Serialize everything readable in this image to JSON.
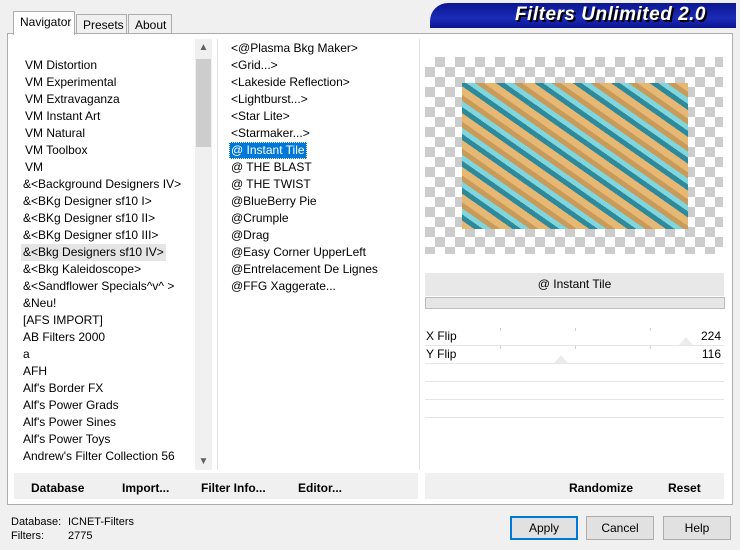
{
  "app": {
    "title": "Filters Unlimited 2.0"
  },
  "tabs": [
    {
      "label": "Navigator",
      "active": true
    },
    {
      "label": "Presets",
      "active": false
    },
    {
      "label": "About",
      "active": false
    }
  ],
  "categories": [
    "VM Distortion",
    "VM Experimental",
    "VM Extravaganza",
    "VM Instant Art",
    "VM Natural",
    "VM Toolbox",
    "VM",
    "&<Background Designers IV>",
    "&<BKg Designer sf10 I>",
    "&<BKg Designer sf10 II>",
    "&<BKg Designer sf10 III>",
    "&<Bkg Designers sf10 IV>",
    "&<Bkg Kaleidoscope>",
    "&<Sandflower Specials^v^ >",
    "&Neu!",
    "[AFS IMPORT]",
    "AB Filters 2000",
    "a",
    "AFH",
    "Alf's Border FX",
    "Alf's Power Grads",
    "Alf's Power Sines",
    "Alf's Power Toys",
    "Andrew's Filter Collection 56"
  ],
  "categories_highlighted": "&<Bkg Designers sf10 IV>",
  "filters": [
    "<@Plasma Bkg Maker>",
    "<Grid...>",
    "<Lakeside Reflection>",
    "<Lightburst...>",
    "<Star Lite>",
    "<Starmaker...>",
    "@ Instant Tile",
    "@ THE BLAST",
    "@ THE TWIST",
    "@BlueBerry Pie",
    "@Crumple",
    "@Drag",
    "@Easy Corner UpperLeft",
    "@Entrelacement De Lignes",
    "@FFG Xaggerate..."
  ],
  "filters_selected": "@ Instant Tile",
  "preview": {
    "filter_name": "@ Instant Tile"
  },
  "params": [
    {
      "label": "X Flip",
      "value": "224"
    },
    {
      "label": "Y Flip",
      "value": "116"
    }
  ],
  "left_buttons": [
    {
      "label": "Database"
    },
    {
      "label": "Import..."
    },
    {
      "label": "Filter Info..."
    },
    {
      "label": "Editor..."
    }
  ],
  "right_buttons": {
    "randomize": "Randomize",
    "reset": "Reset"
  },
  "status": {
    "database_label": "Database:",
    "database_value": "ICNET-Filters",
    "filters_label": "Filters:",
    "filters_value": "2775"
  },
  "dialog_buttons": {
    "apply": "Apply",
    "cancel": "Cancel",
    "help": "Help"
  },
  "colors": {
    "banner": "#0b1590",
    "selection": "#0078d7"
  }
}
